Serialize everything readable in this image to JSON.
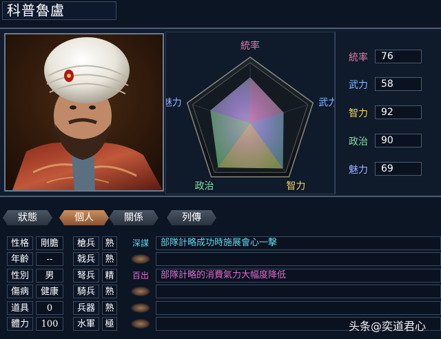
{
  "officer": {
    "name": "科普魯盧"
  },
  "radar": {
    "labels": {
      "lead": "統率",
      "war": "武力",
      "int": "智力",
      "pol": "政治",
      "cha": "魅力"
    },
    "values": {
      "lead": 76,
      "war": 58,
      "int": 92,
      "pol": 90,
      "cha": 69
    },
    "max": 100
  },
  "stats": [
    {
      "label": "統率",
      "value": "76",
      "color": "#e07aa8"
    },
    {
      "label": "武力",
      "value": "58",
      "color": "#7fb8ff"
    },
    {
      "label": "智力",
      "value": "92",
      "color": "#f0d060"
    },
    {
      "label": "政治",
      "value": "90",
      "color": "#7fe0a0"
    },
    {
      "label": "魅力",
      "value": "69",
      "color": "#9ab0ff"
    }
  ],
  "tabs": [
    {
      "label": "狀態",
      "active": false
    },
    {
      "label": "個人",
      "active": true
    },
    {
      "label": "關係",
      "active": false
    },
    {
      "label": "列傳",
      "active": false
    }
  ],
  "personal": [
    {
      "label": "性格",
      "value": "剛膽"
    },
    {
      "label": "年齡",
      "value": "--"
    },
    {
      "label": "性別",
      "value": "男"
    },
    {
      "label": "傷病",
      "value": "健康"
    },
    {
      "label": "道具",
      "value": "0"
    },
    {
      "label": "體力",
      "value": "100"
    }
  ],
  "aptitudes": [
    {
      "label": "槍兵",
      "value": "熟"
    },
    {
      "label": "戟兵",
      "value": "熟"
    },
    {
      "label": "弩兵",
      "value": "精"
    },
    {
      "label": "騎兵",
      "value": "熟"
    },
    {
      "label": "兵器",
      "value": "熟"
    },
    {
      "label": "水軍",
      "value": "極"
    }
  ],
  "skills": [
    {
      "tag": "深謀",
      "tag_color": "#5fd8e8",
      "desc": "部隊計略成功時施展會心一擊",
      "desc_color": "#5fd8e8"
    },
    {
      "tag": "",
      "desc": ""
    },
    {
      "tag": "百出",
      "tag_color": "#e06ad0",
      "desc": "部隊計略的消費氣力大幅度降低",
      "desc_color": "#e06ad0"
    },
    {
      "tag": "",
      "desc": ""
    },
    {
      "tag": "",
      "desc": ""
    },
    {
      "tag": "",
      "desc": ""
    }
  ],
  "watermark": "头条@奕道君心"
}
